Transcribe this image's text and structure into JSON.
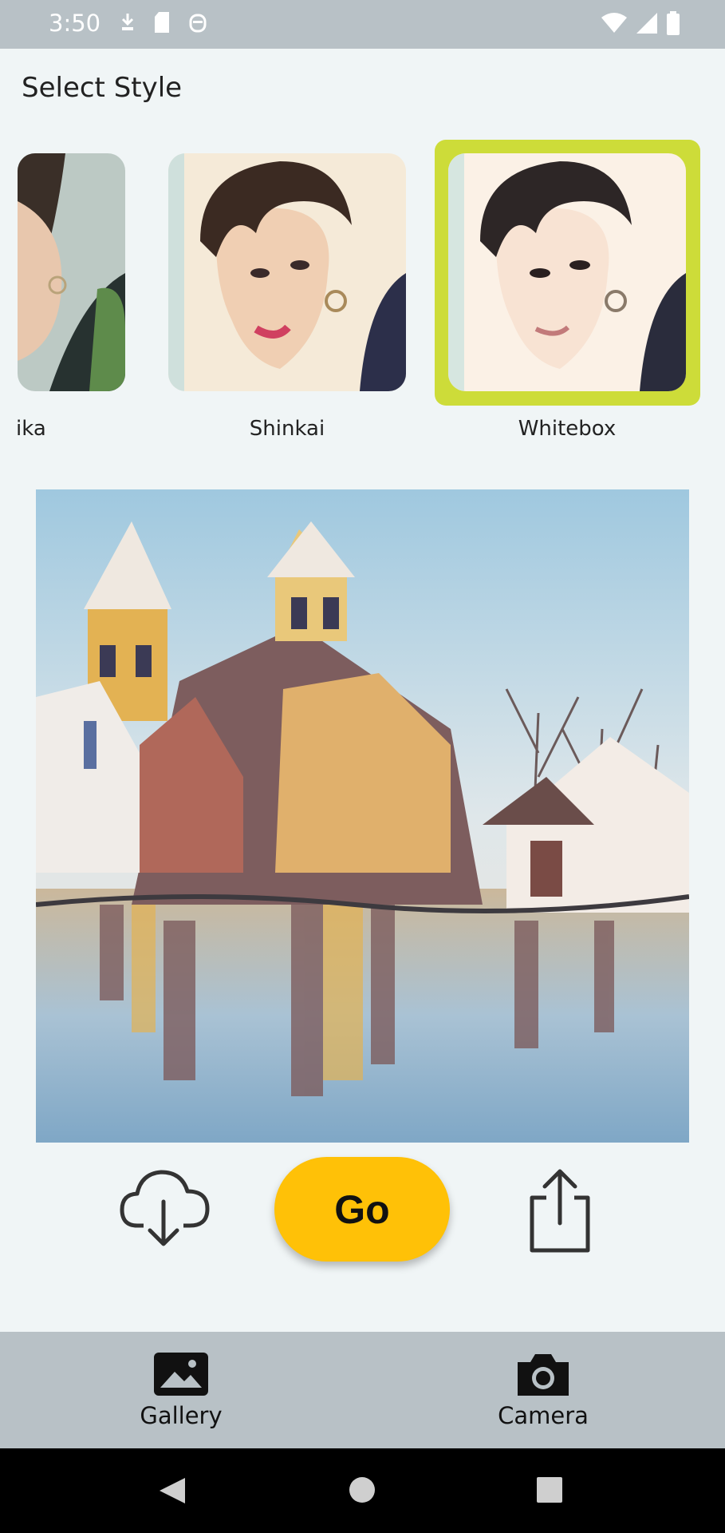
{
  "status_bar": {
    "time": "3:50",
    "left_icons": [
      "download-icon",
      "sd-card-icon",
      "android-debug-icon"
    ],
    "right_icons": [
      "wifi-icon",
      "signal-icon",
      "battery-icon"
    ]
  },
  "page": {
    "title": "Select Style"
  },
  "styles": [
    {
      "label": "ika",
      "selected": false
    },
    {
      "label": "Shinkai",
      "selected": false
    },
    {
      "label": "Whitebox",
      "selected": true
    }
  ],
  "colors": {
    "selected_frame": "#cddc39",
    "scroll_indicator": "#6fbf8e",
    "go_button": "#ffc107",
    "nav_background": "#b8c1c6"
  },
  "actions": {
    "go_label": "Go",
    "download_icon": "cloud-download-icon",
    "share_icon": "share-icon"
  },
  "bottom_nav": {
    "gallery_label": "Gallery",
    "camera_label": "Camera"
  },
  "system_nav": {
    "icons": [
      "back-icon",
      "home-icon",
      "recents-icon"
    ]
  }
}
